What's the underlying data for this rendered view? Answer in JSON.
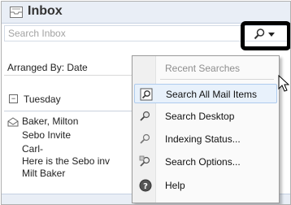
{
  "header": {
    "title": "Inbox"
  },
  "search": {
    "placeholder": "Search Inbox"
  },
  "list": {
    "arranged_by": "Arranged By: Date",
    "group_label": "Tuesday",
    "collapse_symbol": "−",
    "item": {
      "sender": "Baker, Milton",
      "subject": "Sebo Invite",
      "preview_1": "Carl-",
      "preview_2": "Here is the Sebo inv",
      "preview_3": "Milt Baker"
    }
  },
  "menu": {
    "items": [
      {
        "label": "Recent Searches",
        "icon": "none",
        "enabled": false
      },
      {
        "label": "Search All Mail Items",
        "icon": "search-all-mail-icon",
        "enabled": true
      },
      {
        "label": "Search Desktop",
        "icon": "desktop-search-icon",
        "enabled": true
      },
      {
        "label": "Indexing Status...",
        "icon": "magnifier-icon",
        "enabled": true
      },
      {
        "label": "Search Options...",
        "icon": "search-options-icon",
        "enabled": true
      },
      {
        "label": "Help",
        "icon": "help-icon",
        "enabled": true
      }
    ]
  },
  "colors": {
    "header_bg": "#e9eef6",
    "menu_hover_bg": "#e8f1fb",
    "menu_hover_border": "#aecbee",
    "highlight_border": "#000000"
  }
}
